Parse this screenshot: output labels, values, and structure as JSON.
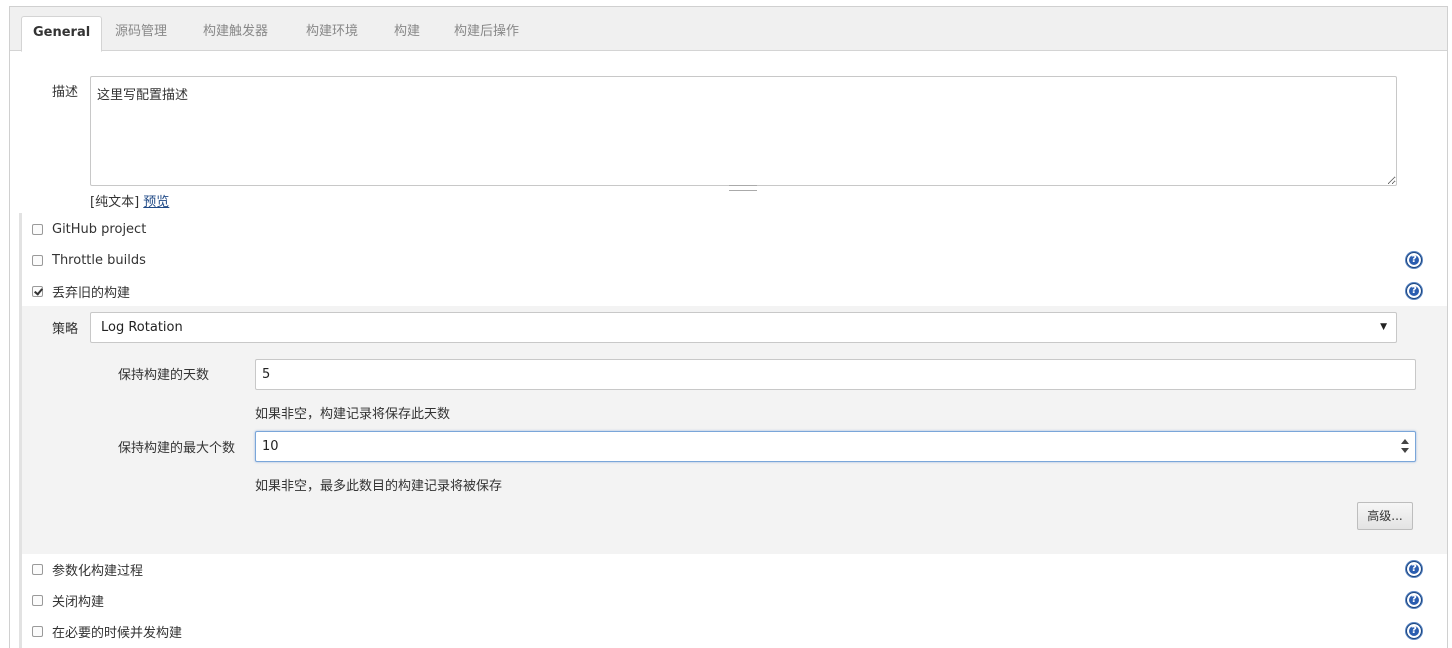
{
  "tabs": [
    {
      "label": "General",
      "active": true
    },
    {
      "label": "源码管理"
    },
    {
      "label": "构建触发器"
    },
    {
      "label": "构建环境"
    },
    {
      "label": "构建"
    },
    {
      "label": "构建后操作"
    }
  ],
  "description": {
    "label": "描述",
    "value": "这里写配置描述",
    "plain_text": "[纯文本]",
    "preview_link": "预览"
  },
  "options": {
    "github_project": {
      "label": "GitHub project",
      "checked": false
    },
    "throttle_builds": {
      "label": "Throttle builds",
      "checked": false
    },
    "discard_old": {
      "label": "丢弃旧的构建",
      "checked": true
    },
    "parameterized": {
      "label": "参数化构建过程",
      "checked": false
    },
    "disable_build": {
      "label": "关闭构建",
      "checked": false
    },
    "concurrent": {
      "label": "在必要的时候并发构建",
      "checked": false
    }
  },
  "strategy": {
    "label": "策略",
    "selected": "Log Rotation",
    "days_label": "保持构建的天数",
    "days_value": "5",
    "days_hint": "如果非空，构建记录将保存此天数",
    "max_label": "保持构建的最大个数",
    "max_value": "10",
    "max_hint": "如果非空，最多此数目的构建记录将被保存",
    "advanced_button": "高级..."
  },
  "help_icon": "?",
  "colors": {
    "help": "#2a5db0",
    "link": "#204a87",
    "focus_border": "#7aa6d9"
  }
}
